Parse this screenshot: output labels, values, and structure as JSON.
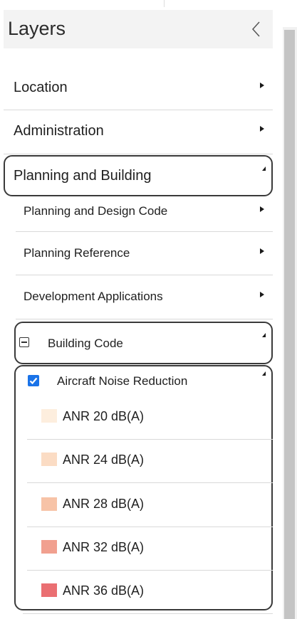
{
  "panel": {
    "title": "Layers"
  },
  "menu": {
    "location": "Location",
    "administration": "Administration",
    "planning_building": "Planning and Building",
    "planning_design_code": "Planning and Design Code",
    "planning_reference": "Planning Reference",
    "development_applications": "Development Applications",
    "building_code": "Building Code",
    "aircraft_noise_reduction": "Aircraft Noise Reduction"
  },
  "legend": [
    {
      "label": "ANR 20 dB(A)",
      "color": "#fdeede"
    },
    {
      "label": "ANR 24 dB(A)",
      "color": "#fbdcc4"
    },
    {
      "label": "ANR 28 dB(A)",
      "color": "#f7c3a7"
    },
    {
      "label": "ANR 32 dB(A)",
      "color": "#f1a08f"
    },
    {
      "label": "ANR 36 dB(A)",
      "color": "#ea6f72"
    }
  ],
  "colors": {
    "checkbox": "#1a73e8"
  }
}
